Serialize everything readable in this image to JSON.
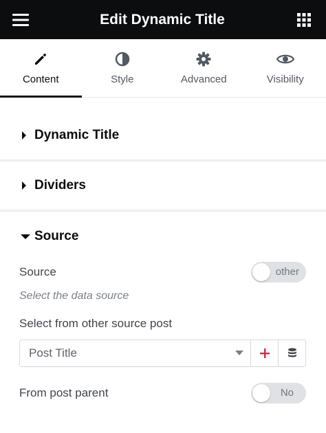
{
  "header": {
    "title": "Edit Dynamic Title",
    "menu_icon": "hamburger-icon",
    "apps_icon": "grid-icon"
  },
  "tabs": [
    {
      "label": "Content",
      "icon": "pencil-icon",
      "active": true
    },
    {
      "label": "Style",
      "icon": "half-circle-icon",
      "active": false
    },
    {
      "label": "Advanced",
      "icon": "gear-icon",
      "active": false
    },
    {
      "label": "Visibility",
      "icon": "eye-icon",
      "active": false
    }
  ],
  "sections": {
    "dynamic_title": {
      "label": "Dynamic Title",
      "expanded": false
    },
    "dividers": {
      "label": "Dividers",
      "expanded": false
    },
    "source": {
      "label": "Source",
      "expanded": true
    }
  },
  "source": {
    "source_label": "Source",
    "source_toggle_text": "other",
    "description": "Select the data source",
    "select_label": "Select from other source post",
    "select_value": "Post Title",
    "parent_label": "From post parent",
    "parent_toggle_text": "No"
  },
  "colors": {
    "header_bg": "#0c0d0e",
    "add_icon": "#d72b3f",
    "toggle_bg": "#dfe1e4"
  }
}
